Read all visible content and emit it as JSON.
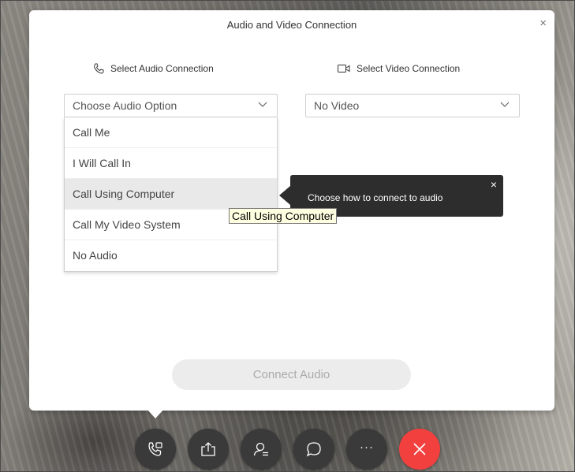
{
  "dialog": {
    "title": "Audio and Video Connection",
    "close_glyph": "×"
  },
  "audio": {
    "label": "Select Audio Connection",
    "icon": "phone-icon",
    "selected": "Choose Audio Option",
    "options": [
      "Call Me",
      "I Will Call In",
      "Call Using Computer",
      "Call My Video System",
      "No Audio"
    ],
    "highlighted_option": "Call Using Computer"
  },
  "video": {
    "label": "Select Video Connection",
    "icon": "video-camera-icon",
    "selected": "No Video"
  },
  "callout": {
    "text": "Choose how to connect to audio",
    "close_glyph": "×"
  },
  "tooltip": {
    "text": "Call Using Computer"
  },
  "connect_button": {
    "label": "Connect Audio",
    "enabled": false
  },
  "toolbar": {
    "buttons": [
      "audio-connect-icon",
      "share-icon",
      "participants-icon",
      "chat-icon",
      "more-icon",
      "end-meeting-icon"
    ],
    "more_glyph": "···"
  },
  "colors": {
    "end_button": "#f2403f",
    "toolbar_button": "#3a3a3a",
    "callout_bg": "#2d2d2d",
    "tooltip_bg": "#ffffe1"
  }
}
